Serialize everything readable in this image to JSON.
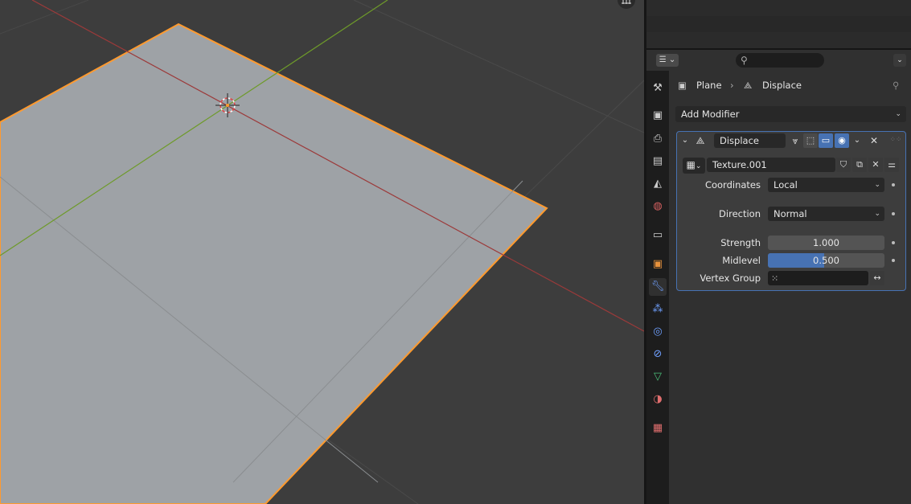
{
  "properties": {
    "header": {
      "editor_type_icon": "properties-editor-icon",
      "search_placeholder": "",
      "search_icon": "magnifier-icon"
    },
    "tabs": [
      {
        "name": "tool",
        "icon": "wrench-screwdriver-icon",
        "color": "#cccccc"
      },
      {
        "name": "render",
        "icon": "camera-back-icon",
        "color": "#cccccc"
      },
      {
        "name": "output",
        "icon": "printer-icon",
        "color": "#cccccc"
      },
      {
        "name": "view-layer",
        "icon": "image-stack-icon",
        "color": "#cccccc"
      },
      {
        "name": "scene",
        "icon": "cone-sphere-icon",
        "color": "#cccccc"
      },
      {
        "name": "world",
        "icon": "globe-icon",
        "color": "#d46060"
      },
      {
        "name": "collection",
        "icon": "box-icon",
        "color": "#cccccc"
      },
      {
        "name": "object",
        "icon": "orange-square-icon",
        "color": "#e8923c"
      },
      {
        "name": "modifiers",
        "icon": "wrench-icon",
        "color": "#6fa0ff",
        "active": true
      },
      {
        "name": "particles",
        "icon": "particles-icon",
        "color": "#6fa0ff"
      },
      {
        "name": "physics",
        "icon": "orbit-circle-icon",
        "color": "#6fa0ff"
      },
      {
        "name": "constraints",
        "icon": "constraint-icon",
        "color": "#6fa0ff"
      },
      {
        "name": "data",
        "icon": "triangle-vertices-icon",
        "color": "#4cc07a"
      },
      {
        "name": "material",
        "icon": "sphere-half-icon",
        "color": "#e06e6e"
      },
      {
        "name": "texture",
        "icon": "checker-icon",
        "color": "#e06e6e"
      }
    ],
    "breadcrumb": {
      "object": "Plane",
      "separator": "›",
      "modifier": "Displace"
    },
    "add_modifier_label": "Add Modifier",
    "modifier": {
      "name": "Displace",
      "texture_name": "Texture.001",
      "coordinates_label": "Coordinates",
      "coordinates_value": "Local",
      "direction_label": "Direction",
      "direction_value": "Normal",
      "strength_label": "Strength",
      "strength_value": "1.000",
      "midlevel_label": "Midlevel",
      "midlevel_value": "0.500",
      "midlevel_fill": 0.48,
      "vertex_group_label": "Vertex Group",
      "vertex_group_value": ""
    }
  },
  "colors": {
    "accent": "#4772b3",
    "selection_outline": "#ff9a2e",
    "x_axis": "#9c3a3a",
    "y_axis": "#6e9a2a",
    "plane": "#9ea2a6"
  }
}
